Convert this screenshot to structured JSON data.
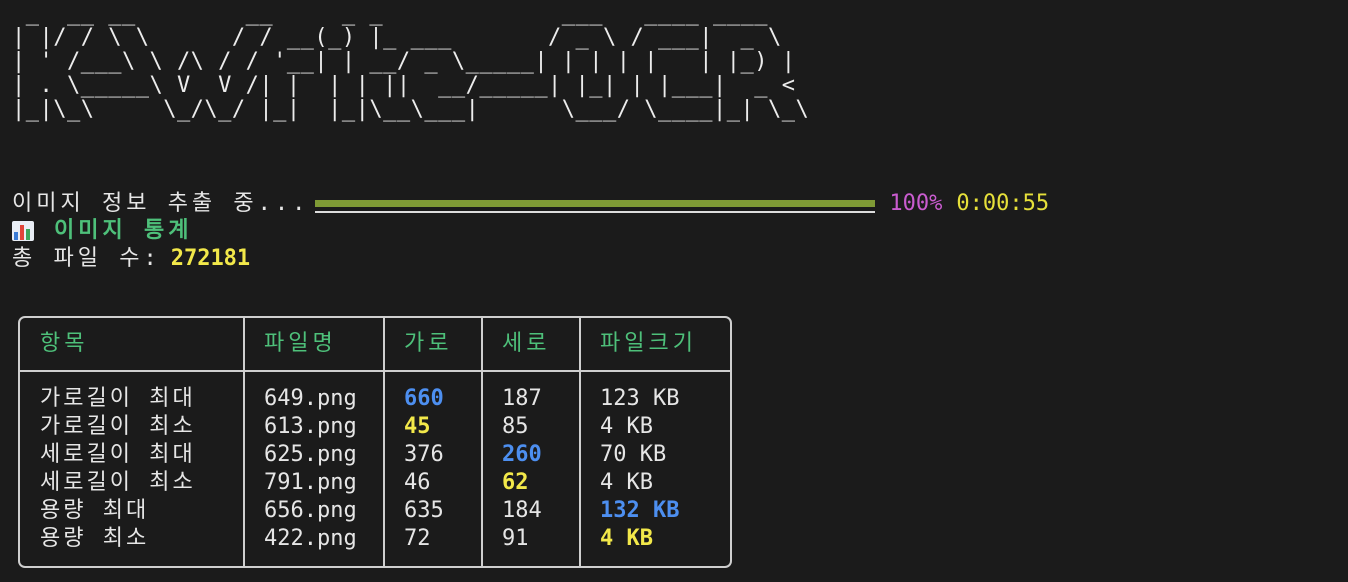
{
  "banner": {
    "art": " _  __ __        __     _ _             ___   ____ ____\n| |/ / \\ \\      / / __(_) |_ ___       / _ \\ / ___|  _ \\\n| ' /___\\ \\ /\\ / / '__| | __/ _ \\_____| | | | |   | |_) |\n| . \\_____\\ V  V /| |  | | ||  __/_____| |_| | |___|  _ <\n|_|\\_\\     \\_/\\_/ |_|  |_|\\__\\___|      \\___/ \\____|_| \\_\\"
  },
  "progress": {
    "label": "이미지 정보 추출 중...",
    "percent_text": "100%",
    "percent": 100,
    "elapsed": "0:00:55",
    "fill_color": "#7f9a35"
  },
  "stats": {
    "icon": "bar-chart-icon",
    "title": "이미지 통계",
    "total_label": "총 파일 수:",
    "total_value": "272181"
  },
  "table": {
    "headers": [
      "항목",
      "파일명",
      "가로",
      "세로",
      "파일크기"
    ],
    "rows": [
      {
        "item": "가로길이 최대",
        "file": "649.png",
        "width": "660",
        "height": "187",
        "size": "123 KB",
        "hl": "width",
        "tone": "blue"
      },
      {
        "item": "가로길이 최소",
        "file": "613.png",
        "width": "45",
        "height": "85",
        "size": "4 KB",
        "hl": "width",
        "tone": "yellow"
      },
      {
        "item": "세로길이 최대",
        "file": "625.png",
        "width": "376",
        "height": "260",
        "size": "70 KB",
        "hl": "height",
        "tone": "blue"
      },
      {
        "item": "세로길이 최소",
        "file": "791.png",
        "width": "46",
        "height": "62",
        "size": "4 KB",
        "hl": "height",
        "tone": "yellow"
      },
      {
        "item": "용량 최대",
        "file": "656.png",
        "width": "635",
        "height": "184",
        "size": "132 KB",
        "hl": "size",
        "tone": "blue"
      },
      {
        "item": "용량 최소",
        "file": "422.png",
        "width": "72",
        "height": "91",
        "size": "4 KB",
        "hl": "size",
        "tone": "yellow"
      }
    ]
  },
  "colors": {
    "background": "#1b1b1b",
    "header_green": "#4ec07a",
    "highlight_blue": "#4d8ff0",
    "highlight_yellow": "#f2e84a",
    "percent_magenta": "#c95ccf"
  }
}
